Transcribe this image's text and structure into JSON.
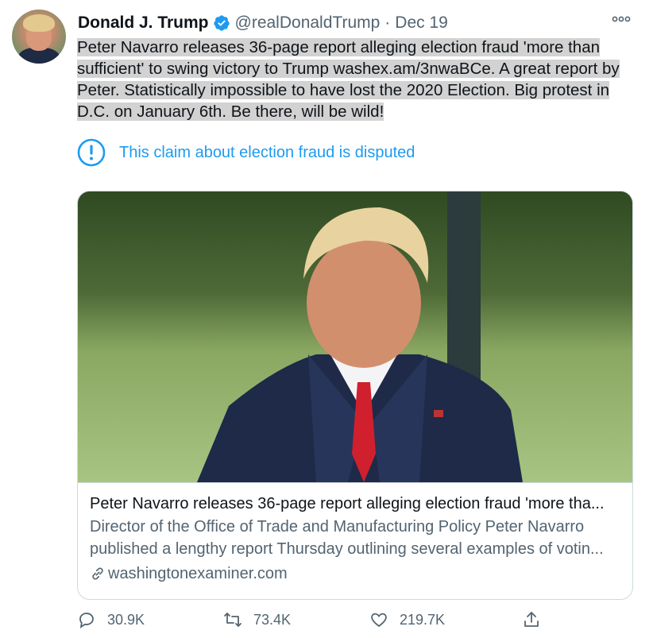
{
  "tweet": {
    "name": "Donald J. Trump",
    "handle": "@realDonaldTrump",
    "separator": "·",
    "date": "Dec 19",
    "verified_icon": "verified-badge-icon",
    "text": "Peter Navarro releases 36-page report alleging election fraud 'more than sufficient' to swing victory to Trump washex.am/3nwaBCe. A great report by Peter. Statistically impossible to have lost the 2020 Election. Big protest in D.C. on January 6th. Be there, will be wild!",
    "notice": "This claim about election fraud is disputed"
  },
  "card": {
    "title": "Peter Navarro releases 36-page report alleging election fraud 'more tha...",
    "description": "Director of the Office of Trade and Manufacturing Policy Peter Navarro published a lengthy report Thursday outlining several examples of votin...",
    "domain": "washingtonexaminer.com"
  },
  "actions": {
    "replies": "30.9K",
    "retweets": "73.4K",
    "likes": "219.7K"
  },
  "colors": {
    "accent": "#1d9bf0",
    "muted": "#536471",
    "highlight": "#d2d2d2"
  }
}
